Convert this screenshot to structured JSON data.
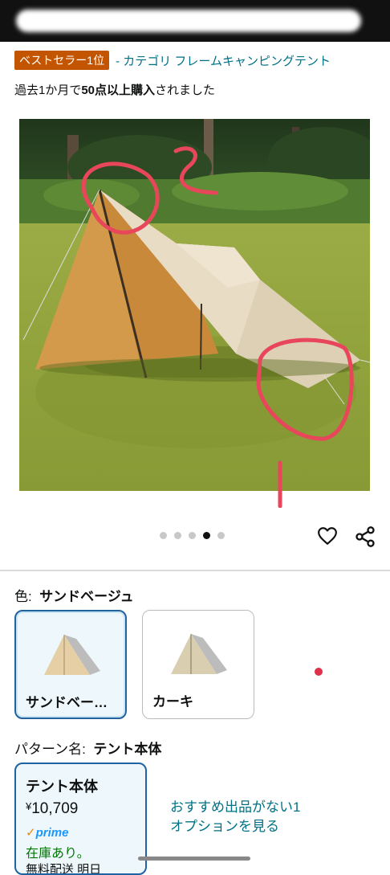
{
  "header": {
    "badge": "ベストセラー1位",
    "category_link": "- カテゴリ フレームキャンピングテント"
  },
  "purchase_note": {
    "prefix": "過去1か月で",
    "bold": "50点以上購入",
    "suffix": "されました"
  },
  "gallery": {
    "image_count": 5,
    "active_index": 3
  },
  "color": {
    "label": "色:",
    "selected": "サンドベージュ",
    "options": [
      {
        "name": "サンドベー…",
        "selected": true,
        "tent_color": "#e6cfa5"
      },
      {
        "name": "カーキ",
        "selected": false,
        "tent_color": "#d9ceb0"
      }
    ]
  },
  "pattern": {
    "label": "パターン名:",
    "selected": "テント本体"
  },
  "option_card": {
    "title": "テント本体",
    "currency": "¥",
    "price": "10,709",
    "prime": "prime",
    "stock": "在庫あり。",
    "shipping": "無料配送 明日"
  },
  "more_offers": "おすすめ出品がない1オプションを見る",
  "colors": {
    "link": "#007185",
    "badge": "#c45500",
    "selected_border": "#2162a1",
    "stock": "#007600"
  }
}
